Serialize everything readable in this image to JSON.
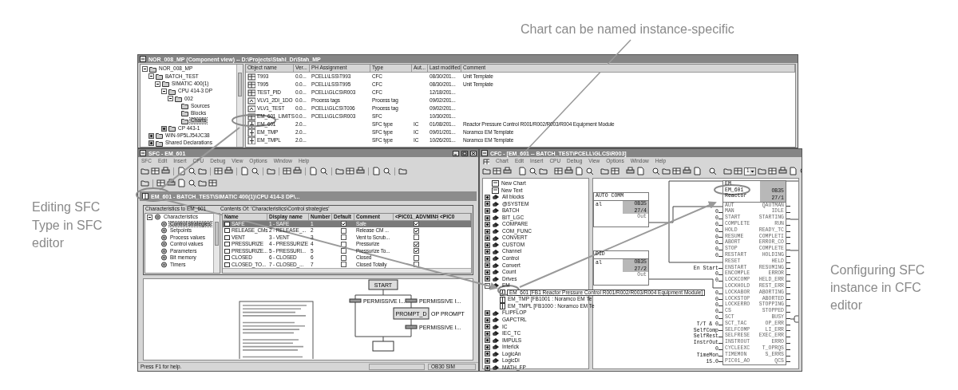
{
  "annotations": [
    {
      "text": "Chart can be named instance-specific"
    },
    {
      "text": "Editing SFC Type in SFC editor"
    },
    {
      "text": "Configuring SFC instance in CFC editor"
    }
  ],
  "component_view": {
    "title": "NOR_008_MP (Component view) -- D:\\Projects\\Stahl_Dr\\Stah_MP",
    "tree": [
      {
        "label": "NOR_008_MP",
        "expanded": true,
        "selected": false,
        "children": [
          {
            "label": "BATCH_TEST",
            "expanded": true,
            "selected": false,
            "children": [
              {
                "label": "SIMATIC 400(1)",
                "expanded": true,
                "selected": false,
                "children": [
                  {
                    "label": "CPU 414-3 DP",
                    "expanded": true,
                    "selected": false,
                    "children": [
                      {
                        "label": "002",
                        "expanded": true,
                        "selected": false,
                        "children": [
                          {
                            "label": "Sources",
                            "selected": false
                          },
                          {
                            "label": "Blocks",
                            "selected": false
                          },
                          {
                            "label": "Charts",
                            "selected": true
                          }
                        ]
                      }
                    ]
                  },
                  {
                    "label": "CP 443-1",
                    "expanded": false,
                    "selected": false
                  }
                ]
              }
            ]
          },
          {
            "label": "WIN-9P5LJ54JC38",
            "expanded": false,
            "selected": false
          },
          {
            "label": "Shared Declarations",
            "expanded": false,
            "selected": false
          }
        ]
      }
    ],
    "columns": [
      "Object name",
      "Ver...",
      "PH Assignment",
      "Type",
      "Aut...",
      "Last modified",
      "Comment"
    ],
    "rows": [
      {
        "kind": "cfc",
        "cells": [
          "T993",
          "0.0...",
          "PCELL\\LSS\\T993",
          "CFC",
          "",
          "08/30/201...",
          "Unit Template"
        ]
      },
      {
        "kind": "cfc",
        "cells": [
          "T995",
          "0.0...",
          "PCELL\\LSS\\T995",
          "CFC",
          "",
          "08/30/201...",
          "Unit Template"
        ]
      },
      {
        "kind": "cfc",
        "cells": [
          "TEST_PID",
          "0.0...",
          "PCELL\\GLCS\\R003",
          "CFC",
          "",
          "12/18/201...",
          ""
        ]
      },
      {
        "kind": "tag",
        "cells": [
          "VLV1_2DI_1DO",
          "0.0...",
          "Process tags",
          "Process tag",
          "",
          "09/02/201...",
          ""
        ]
      },
      {
        "kind": "tag",
        "cells": [
          "VLV1_TEST",
          "0.0...",
          "PCELL\\GLCS\\T006",
          "Process tag",
          "",
          "09/02/201...",
          ""
        ]
      },
      {
        "kind": "cfc",
        "cells": [
          "EM_601_LIMITS",
          "0.0...",
          "PCELL\\GLCS\\R003",
          "SFC",
          "",
          "10/30/201...",
          ""
        ]
      },
      {
        "kind": "sfc",
        "cells": [
          "EM_601",
          "2.0...",
          "",
          "SFC type",
          "IC",
          "01/08/201...",
          "Reactor Pressure Control R001/R002/R003/R004 Equipment Module"
        ]
      },
      {
        "kind": "sfc",
        "cells": [
          "EM_TMP",
          "2.0...",
          "",
          "SFC type",
          "IC",
          "09/01/201...",
          "Noramco EM Template"
        ]
      },
      {
        "kind": "sfc",
        "cells": [
          "EM_TMPL",
          "2.0...",
          "",
          "SFC type",
          "IC",
          "10/26/201...",
          "Noramco EM Template"
        ]
      }
    ]
  },
  "sfc_editor": {
    "title": "SFC - EM_601",
    "menu": [
      "SFC",
      "Edit",
      "Insert",
      "CPU",
      "Debug",
      "View",
      "Options",
      "Window",
      "Help"
    ],
    "object_path": "EM_601 - BATCH_TEST\\SIMATIC 400(1)\\CPU 414-3 DP\\...",
    "tree_title": "Characteristics to EM_601",
    "contents_title": "Contents Of: 'Characteristics\\Control strategies'",
    "tree": [
      {
        "label": "Characteristics",
        "expanded": true,
        "selected": false,
        "children": [
          {
            "label": "Control strategies",
            "selected": true
          },
          {
            "label": "Setpoints",
            "selected": false
          },
          {
            "label": "Process values",
            "selected": false
          },
          {
            "label": "Control values",
            "selected": false
          },
          {
            "label": "Parameters",
            "selected": false
          },
          {
            "label": "Bit memory",
            "selected": false
          },
          {
            "label": "Timers",
            "selected": false
          }
        ]
      }
    ],
    "columns": [
      "Name",
      "Display name",
      "Number",
      "Default",
      "Comment",
      "<PIC01_ADVMIN>",
      "<PIC0"
    ],
    "rows": [
      {
        "name": "SAFE",
        "display_name": "1 - SAFE",
        "number": "1",
        "default": true,
        "comment": "Safe",
        "pic01_advmin": true,
        "selected": true
      },
      {
        "name": "RELEASE_CMs",
        "display_name": "2 - RELEASE_...",
        "number": "2",
        "default": false,
        "comment": "Release CM ...",
        "pic01_advmin": true,
        "selected": false
      },
      {
        "name": "VENT",
        "display_name": "3 - VENT",
        "number": "3",
        "default": false,
        "comment": "Vent to Scrub...",
        "pic01_advmin": false,
        "selected": false
      },
      {
        "name": "PRESSURIZE",
        "display_name": "4 - PRESSURIZE",
        "number": "4",
        "default": false,
        "comment": "Pressurize",
        "pic01_advmin": true,
        "selected": false
      },
      {
        "name": "PRESSURIZE...",
        "display_name": "5 - PRESSURI...",
        "number": "5",
        "default": false,
        "comment": "Pressurize To...",
        "pic01_advmin": true,
        "selected": false
      },
      {
        "name": "CLOSED",
        "display_name": "6 - CLOSED",
        "number": "6",
        "default": false,
        "comment": "Closed",
        "pic01_advmin": false,
        "selected": false
      },
      {
        "name": "CLOSED_TO...",
        "display_name": "7 - CLOSED_...",
        "number": "7",
        "default": false,
        "comment": "Closed Totally",
        "pic01_advmin": false,
        "selected": false
      }
    ],
    "graph": {
      "start_step": "START",
      "prompt_step": "PROMPT_D",
      "prompt_comment": "OP PROMPT",
      "transition_labels": [
        "PERMISSIVE I...",
        "PERMISSIVE I...",
        "PERMISSIVE I..."
      ]
    },
    "status": "Press F1 for help.",
    "status_right": "OB30  SIM"
  },
  "cfc_editor": {
    "title": "CFC - [EM_601 -- BATCH_TEST\\PCELL\\GLCS\\R003]",
    "menu": [
      "Chart",
      "Edit",
      "Insert",
      "CPU",
      "Debug",
      "View",
      "Options",
      "Window",
      "Help"
    ],
    "zoom": "1",
    "library": [
      {
        "label": "New Chart",
        "kind": "chart"
      },
      {
        "label": "New Text",
        "kind": "chart"
      },
      {
        "label": "All blocks",
        "kind": "folder",
        "expanded": false
      },
      {
        "label": "@SYSTEM",
        "kind": "folder",
        "expanded": false
      },
      {
        "label": "BATCH",
        "kind": "folder",
        "expanded": false
      },
      {
        "label": "BIT_LGC",
        "kind": "folder",
        "expanded": false
      },
      {
        "label": "COMPARE",
        "kind": "folder",
        "expanded": false
      },
      {
        "label": "COM_FUNC",
        "kind": "folder",
        "expanded": false
      },
      {
        "label": "CONVERT",
        "kind": "folder",
        "expanded": false
      },
      {
        "label": "CUSTOM",
        "kind": "folder",
        "expanded": false
      },
      {
        "label": "Channel",
        "kind": "folder",
        "expanded": false
      },
      {
        "label": "Control",
        "kind": "folder",
        "expanded": false
      },
      {
        "label": "Convert",
        "kind": "folder",
        "expanded": false
      },
      {
        "label": "Count",
        "kind": "folder",
        "expanded": false
      },
      {
        "label": "Drives",
        "kind": "folder",
        "expanded": false
      },
      {
        "label": "EM",
        "kind": "folder",
        "expanded": true,
        "children": [
          {
            "label": "EM_601 [FB1 Reactor Pressure Control R001/R002/R003/R004 Equipment Module]",
            "kind": "block",
            "hovered": true
          },
          {
            "label": "EM_TMP [FB1001 : Noramco EM Te",
            "kind": "block",
            "hovered": false
          },
          {
            "label": "EM_TMPL [FB1000 : Noramco EM Te",
            "kind": "block",
            "hovered": false
          }
        ]
      },
      {
        "label": "FLIPFLOP",
        "kind": "folder",
        "expanded": false
      },
      {
        "label": "GAPCTRL",
        "kind": "folder",
        "expanded": false
      },
      {
        "label": "IC",
        "kind": "folder",
        "expanded": false
      },
      {
        "label": "IEC_TC",
        "kind": "folder",
        "expanded": false
      },
      {
        "label": "IMPULS",
        "kind": "folder",
        "expanded": false
      },
      {
        "label": "Interlck",
        "kind": "folder",
        "expanded": false
      },
      {
        "label": "LogicAn",
        "kind": "folder",
        "expanded": false
      },
      {
        "label": "LogicDi",
        "kind": "folder",
        "expanded": false
      },
      {
        "label": "MATH_FP",
        "kind": "folder",
        "expanded": false
      }
    ],
    "small_blocks": [
      {
        "header": "AUTO COMM",
        "pin": "al",
        "task": "OB35",
        "order": "27/4",
        "output": "Out"
      },
      {
        "header": "DID",
        "pin": "al",
        "task": "OB35",
        "order": "27/2",
        "output": "Out"
      }
    ],
    "block": {
      "header": [
        "EM",
        "EM_601",
        "Reactor"
      ],
      "task": "OB35",
      "order": "27/1",
      "inputs": [
        {
          "name": "AUT"
        },
        {
          "value": "0",
          "name": "MAN"
        },
        {
          "value": "0",
          "name": "START"
        },
        {
          "value": "0",
          "name": "COMPLETE"
        },
        {
          "value": "0",
          "name": "HOLD"
        },
        {
          "value": "0",
          "name": "RESUME"
        },
        {
          "value": "0",
          "name": "ABORT"
        },
        {
          "value": "0",
          "name": "STOP"
        },
        {
          "value": "0",
          "name": "RESTART"
        },
        {
          "name": "RESET"
        },
        {
          "value": "En Start",
          "name": "ENSTART"
        },
        {
          "value": "0",
          "name": "ENCOMPLE"
        },
        {
          "value": "0",
          "name": "LOCKCOMP"
        },
        {
          "name": "LOCKHOLD"
        },
        {
          "value": "0",
          "name": "LOCKABOR"
        },
        {
          "value": "0",
          "name": "LOCKSTOP"
        },
        {
          "value": "0",
          "name": "LOCKERRO"
        },
        {
          "value": "0",
          "name": "CS"
        },
        {
          "value": "0",
          "name": "SCT"
        },
        {
          "value": "T/T & 0",
          "name": "SCT_TAC"
        },
        {
          "value": "SelfComp",
          "name": "SELFCOMP"
        },
        {
          "value": "SelfRest",
          "name": "SELFRESE"
        },
        {
          "value": "InstrOut",
          "name": "INSTROUT"
        },
        {
          "value": "0",
          "name": "CYCLEEXC"
        },
        {
          "value": "TimeMon",
          "name": "TIMEMON"
        },
        {
          "value": "15.0",
          "name": "PIC01_AO"
        }
      ],
      "outputs": [
        "QAUTMAN",
        "IDLE",
        "STARTING",
        "RUN",
        "READY_TC",
        "COMPLETI",
        "ERROR_CO",
        "COMPLETE",
        "HOLDING",
        "HELD",
        "RESUMING",
        "ERROR",
        "HELD_ERR",
        "REST_ERR",
        "ABORTING",
        "ABORTED",
        "STOPPING",
        "STOPPED",
        "BUSY",
        "OP_ERR",
        "LI_ERR",
        "EXEC_ERR",
        "ERRO",
        "T_OPRQS",
        "S_ERRS",
        "QCS"
      ]
    }
  }
}
